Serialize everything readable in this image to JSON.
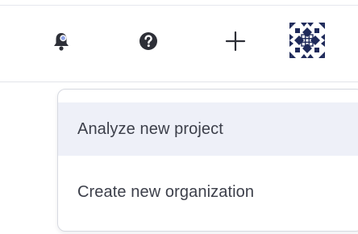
{
  "header": {
    "icons": [
      {
        "name": "notifications-icon"
      },
      {
        "name": "help-icon"
      },
      {
        "name": "add-icon"
      },
      {
        "name": "user-avatar"
      }
    ]
  },
  "colors": {
    "icon": "#2d2f37",
    "notification_dot": "#8ea2e6",
    "avatar": "#1f2a5a",
    "menu_text": "#3c3f4a",
    "menu_active_bg": "#eef0f8",
    "divider": "#e3e5ea"
  },
  "dropdown": {
    "items": [
      {
        "label": "Analyze new project",
        "highlighted": true
      },
      {
        "label": "Create new organization",
        "highlighted": false
      }
    ]
  }
}
